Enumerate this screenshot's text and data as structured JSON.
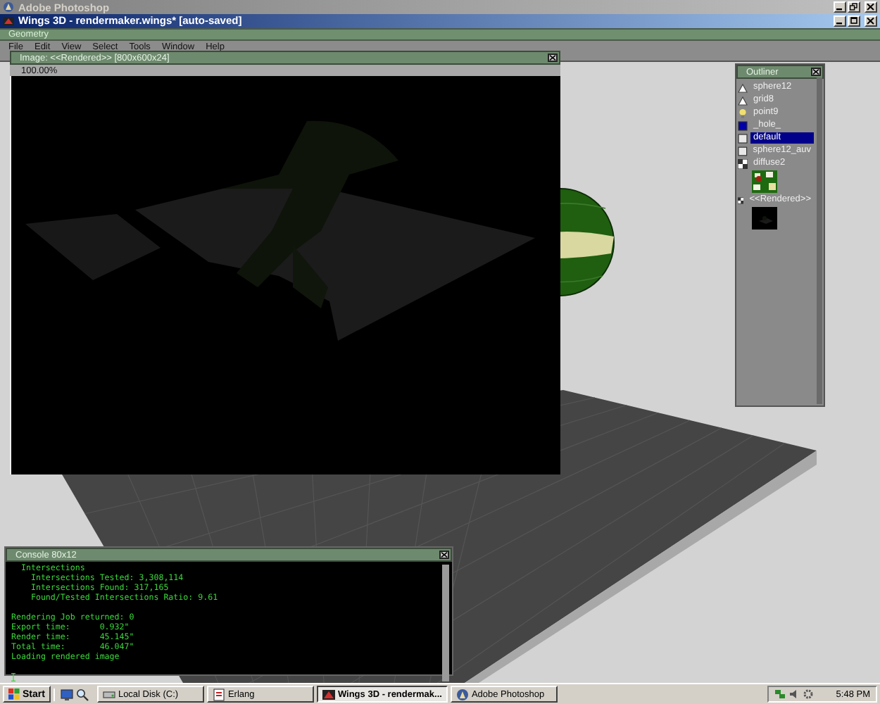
{
  "photoshop_window": {
    "title": "Adobe Photoshop",
    "active": false
  },
  "wings_window": {
    "title": "Wings 3D - rendermaker.wings* [auto-saved]",
    "active": true
  },
  "geometry_bar": {
    "title": "Geometry"
  },
  "menu": [
    "File",
    "Edit",
    "View",
    "Select",
    "Tools",
    "Window",
    "Help"
  ],
  "image_window": {
    "title": "Image: <<Rendered>> [800x600x24]",
    "zoom": "100.00%"
  },
  "outliner": {
    "title": "Outliner",
    "items": [
      {
        "label": "sphere12",
        "kind": "object",
        "selected": false
      },
      {
        "label": "grid8",
        "kind": "object",
        "selected": false
      },
      {
        "label": "point9",
        "kind": "light",
        "selected": false
      },
      {
        "label": "_hole_",
        "kind": "material",
        "color": "#0000aa",
        "selected": false
      },
      {
        "label": "default",
        "kind": "material",
        "color": "#e8e8e8",
        "selected": true
      },
      {
        "label": "sphere12_auv",
        "kind": "material",
        "color": "#e8e8e8",
        "selected": false
      },
      {
        "label": "diffuse2",
        "selected": false
      },
      {
        "label": "<<Rendered>>",
        "selected": false
      }
    ]
  },
  "console": {
    "title": "Console 80x12",
    "blocks": [
      [
        "  Intersections",
        "    Intersections Tested: 3,308,114",
        "    Intersections Found: 317,165",
        "    Found/Tested Intersections Ratio: 9.61"
      ],
      [
        "Rendering Job returned: 0",
        "Export time:      0.932\"",
        "Render time:      45.145\"",
        "Total time:       46.047\"",
        "Loading rendered image"
      ]
    ]
  },
  "taskbar": {
    "start": "Start",
    "tasks": [
      {
        "label": "Local Disk (C:)",
        "kind": "drive",
        "selected": false
      },
      {
        "label": "Erlang",
        "kind": "erlang",
        "selected": false
      },
      {
        "label": "Wings 3D - rendermak...",
        "kind": "wings",
        "selected": true
      },
      {
        "label": "Adobe Photoshop",
        "kind": "photoshop",
        "selected": false
      }
    ],
    "clock": "5:48 PM"
  }
}
